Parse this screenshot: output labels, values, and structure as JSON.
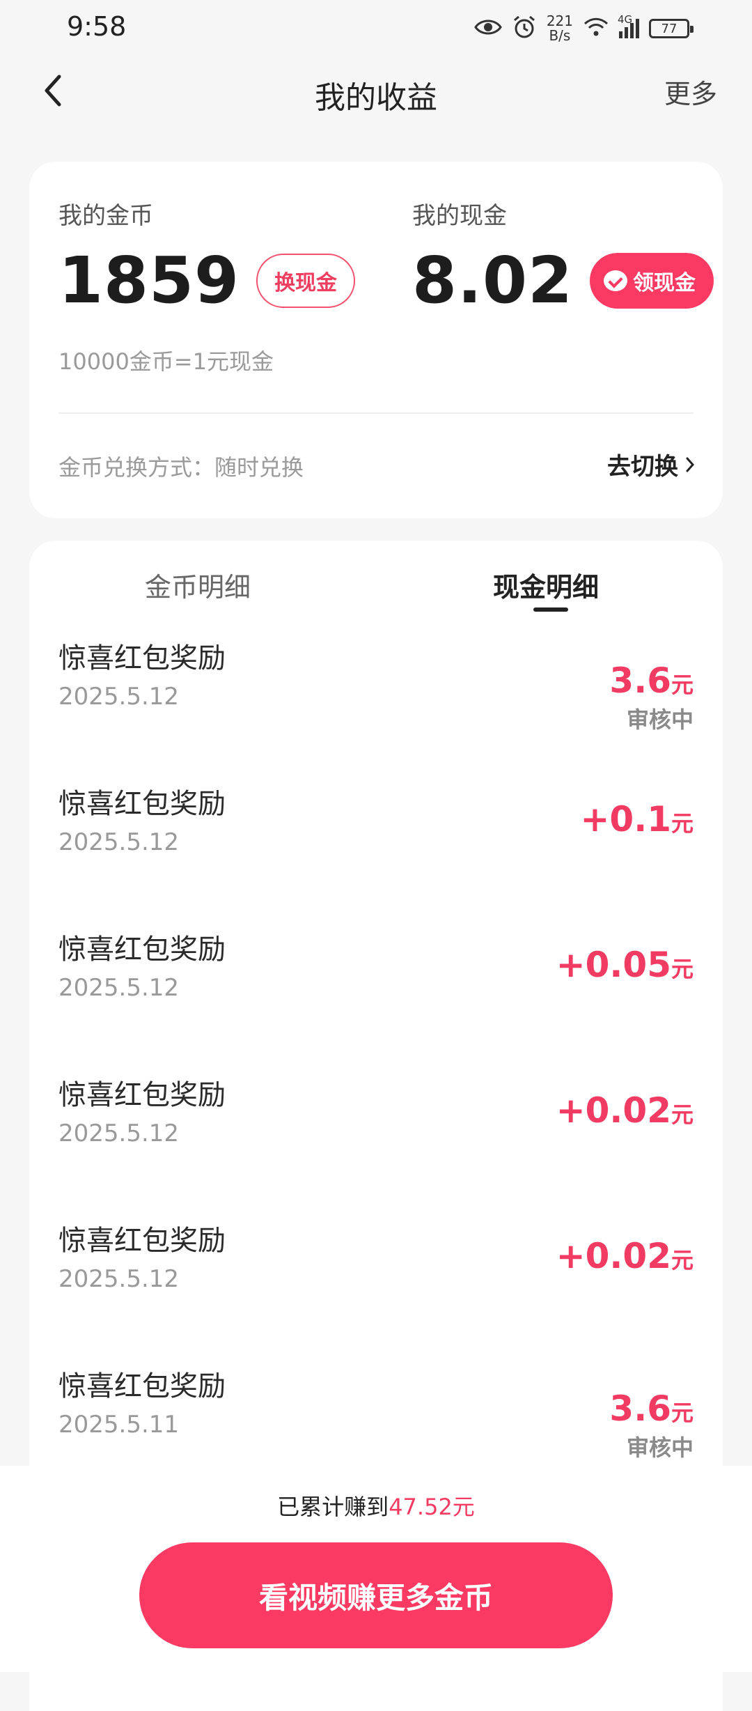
{
  "status_bar": {
    "time": "9:58",
    "net_speed_value": "221",
    "net_speed_unit": "B/s",
    "network": "4G",
    "battery": "77"
  },
  "header": {
    "title": "我的收益",
    "more_label": "更多"
  },
  "summary": {
    "coin_label": "我的金币",
    "coin_value": "1859",
    "exchange_label": "换现金",
    "cash_label": "我的现金",
    "cash_value": "8.02",
    "claim_label": "领现金",
    "rate_text": "10000金币=1元现金",
    "mode_text": "金币兑换方式：随时兑换",
    "switch_label": "去切换"
  },
  "tabs": [
    {
      "label": "金币明细",
      "active": false
    },
    {
      "label": "现金明细",
      "active": true
    }
  ],
  "records": [
    {
      "title": "惊喜红包奖励",
      "date": "2025.5.12",
      "amount": "3.6",
      "unit": "元",
      "status": "审核中"
    },
    {
      "title": "惊喜红包奖励",
      "date": "2025.5.12",
      "amount": "+0.1",
      "unit": "元",
      "status": ""
    },
    {
      "title": "惊喜红包奖励",
      "date": "2025.5.12",
      "amount": "+0.05",
      "unit": "元",
      "status": ""
    },
    {
      "title": "惊喜红包奖励",
      "date": "2025.5.12",
      "amount": "+0.02",
      "unit": "元",
      "status": ""
    },
    {
      "title": "惊喜红包奖励",
      "date": "2025.5.12",
      "amount": "+0.02",
      "unit": "元",
      "status": ""
    },
    {
      "title": "惊喜红包奖励",
      "date": "2025.5.11",
      "amount": "3.6",
      "unit": "元",
      "status": "审核中"
    }
  ],
  "footer": {
    "total_prefix": "已累计赚到",
    "total_value": "47.52元",
    "cta_label": "看视频赚更多金币"
  },
  "colors": {
    "accent": "#fb3a64",
    "amount_text": "#f23b62",
    "background": "#f6f6f6"
  }
}
